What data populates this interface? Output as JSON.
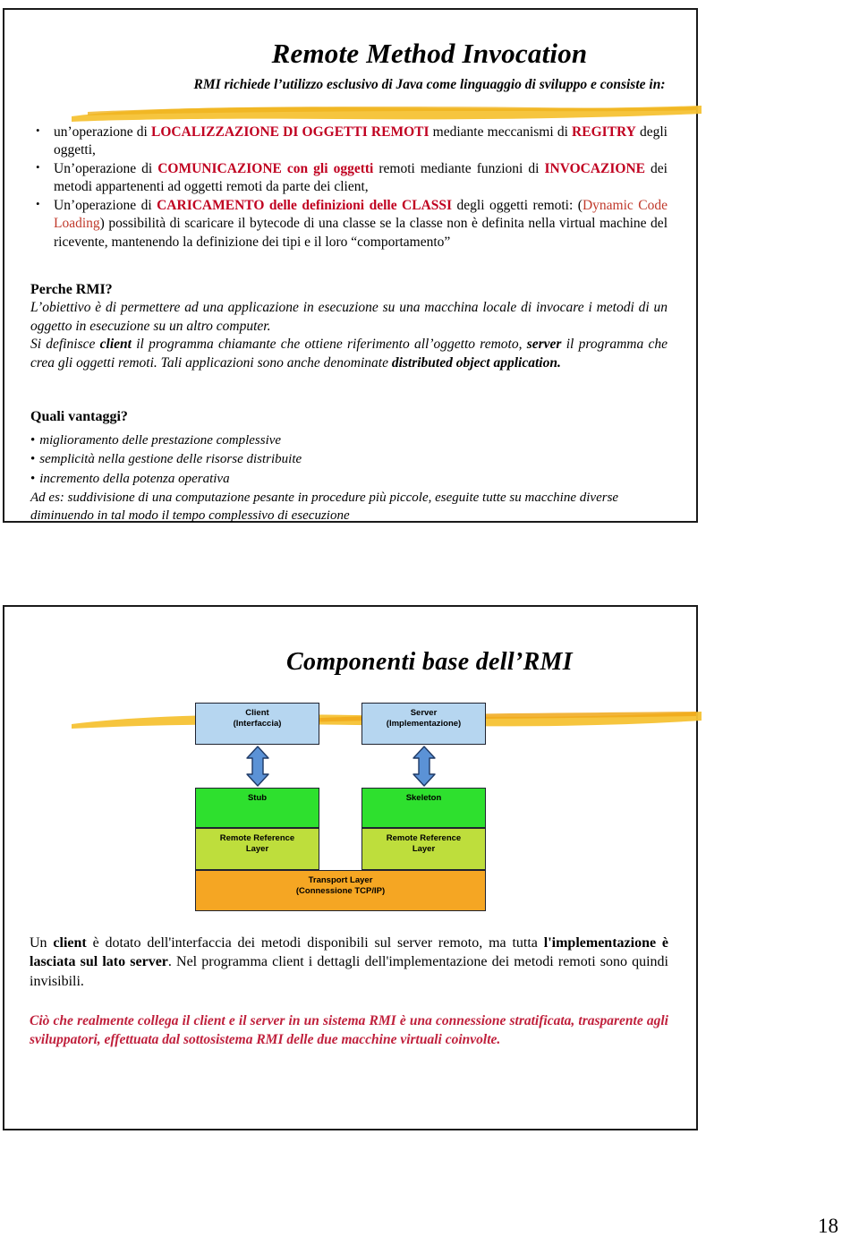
{
  "page": {
    "number": "18",
    "brush_color": "#f5c234",
    "accent_red": "#c00020",
    "accent_red_soft": "#c0392b",
    "quote_red": "#c0203c"
  },
  "slide1": {
    "title": "Remote Method Invocation",
    "subtitle": "RMI richiede l’utilizzo esclusivo di Java come linguaggio di sviluppo e consiste in:",
    "bullets": [
      {
        "parts": [
          {
            "text": "un’operazione di ",
            "style": "plain"
          },
          {
            "text": "LOCALIZZAZIONE DI OGGETTI REMOTI",
            "style": "red"
          },
          {
            "text": " mediante meccanismi di ",
            "style": "plain"
          },
          {
            "text": "REGITRY",
            "style": "red"
          },
          {
            "text": " degli oggetti,",
            "style": "plain"
          }
        ]
      },
      {
        "parts": [
          {
            "text": "Un’operazione di ",
            "style": "plain"
          },
          {
            "text": "COMUNICAZIONE con gli oggetti",
            "style": "red"
          },
          {
            "text": " remoti mediante funzioni di ",
            "style": "plain"
          },
          {
            "text": "INVOCAZIONE",
            "style": "red"
          },
          {
            "text": " dei metodi appartenenti ad oggetti remoti da parte dei client,",
            "style": "plain"
          }
        ]
      },
      {
        "parts": [
          {
            "text": "Un’operazione di ",
            "style": "plain"
          },
          {
            "text": "CARICAMENTO delle definizioni delle CLASSI",
            "style": "red"
          },
          {
            "text": " degli oggetti remoti: (",
            "style": "plain"
          },
          {
            "text": "Dynamic Code Loading",
            "style": "red-soft"
          },
          {
            "text": ") possibilità di scaricare il bytecode di una classe se la classe non è definita nella virtual machine del ricevente, mantenendo la definizione dei tipi e il loro “comportamento”",
            "style": "plain"
          }
        ]
      }
    ],
    "why_heading": "Perche RMI?",
    "why_paragraph": [
      {
        "text": "L’obiettivo è di permettere ad una applicazione in esecuzione su una macchina locale di invocare i metodi di un oggetto in esecuzione su un altro computer.",
        "style": "italic"
      }
    ],
    "why_paragraph2": [
      {
        "text": "Si definisce ",
        "style": "italic"
      },
      {
        "text": "client",
        "style": "italic-bold"
      },
      {
        "text": " il programma chiamante che ottiene riferimento all’oggetto remoto, ",
        "style": "italic"
      },
      {
        "text": "server",
        "style": "italic-bold"
      },
      {
        "text": " il programma che crea gli oggetti remoti. Tali applicazioni sono anche denominate ",
        "style": "italic"
      },
      {
        "text": "distributed object application.",
        "style": "italic-bold"
      }
    ],
    "advantages_heading": "Quali vantaggi?",
    "advantages": [
      "miglioramento delle prestazione complessive",
      "semplicità nella gestione delle risorse distribuite",
      "incremento della potenza operativa"
    ],
    "advantages_note": "Ad es: suddivisione di una computazione pesante  in procedure più piccole, eseguite tutte su macchine diverse diminuendo in tal modo il tempo complessivo di esecuzione"
  },
  "slide2": {
    "title": "Componenti base dell’RMI",
    "diagram": {
      "client": {
        "line1": "Client",
        "line2": "(Interfaccia)",
        "color": "#b6d6f0"
      },
      "server": {
        "line1": "Server",
        "line2": "(Implementazione)",
        "color": "#b6d6f0"
      },
      "stub": {
        "line1": "Stub",
        "color": "#2ee02e"
      },
      "skeleton": {
        "line1": "Skeleton",
        "color": "#2ee02e"
      },
      "rrl_left": {
        "line1": "Remote Reference",
        "line2": "Layer",
        "color": "#bede3c"
      },
      "rrl_right": {
        "line1": "Remote Reference",
        "line2": "Layer",
        "color": "#bede3c"
      },
      "transport": {
        "line1": "Transport Layer",
        "line2": "(Connessione TCP/IP)",
        "color": "#f5a623"
      }
    },
    "paragraph": [
      {
        "text": "Un ",
        "style": "plain"
      },
      {
        "text": "client",
        "style": "bold"
      },
      {
        "text": " è dotato dell'interfaccia dei metodi disponibili sul server remoto, ma tutta ",
        "style": "plain"
      },
      {
        "text": "l'implementazione è lasciata sul lato server",
        "style": "bold"
      },
      {
        "text": ". Nel programma client i dettagli dell'implementazione dei metodi remoti sono quindi invisibili.",
        "style": "plain"
      }
    ],
    "quote": "Ciò che realmente collega il client e il server in un sistema RMI è una connessione stratificata, trasparente agli sviluppatori, effettuata dal sottosistema RMI delle due macchine virtuali coinvolte."
  }
}
